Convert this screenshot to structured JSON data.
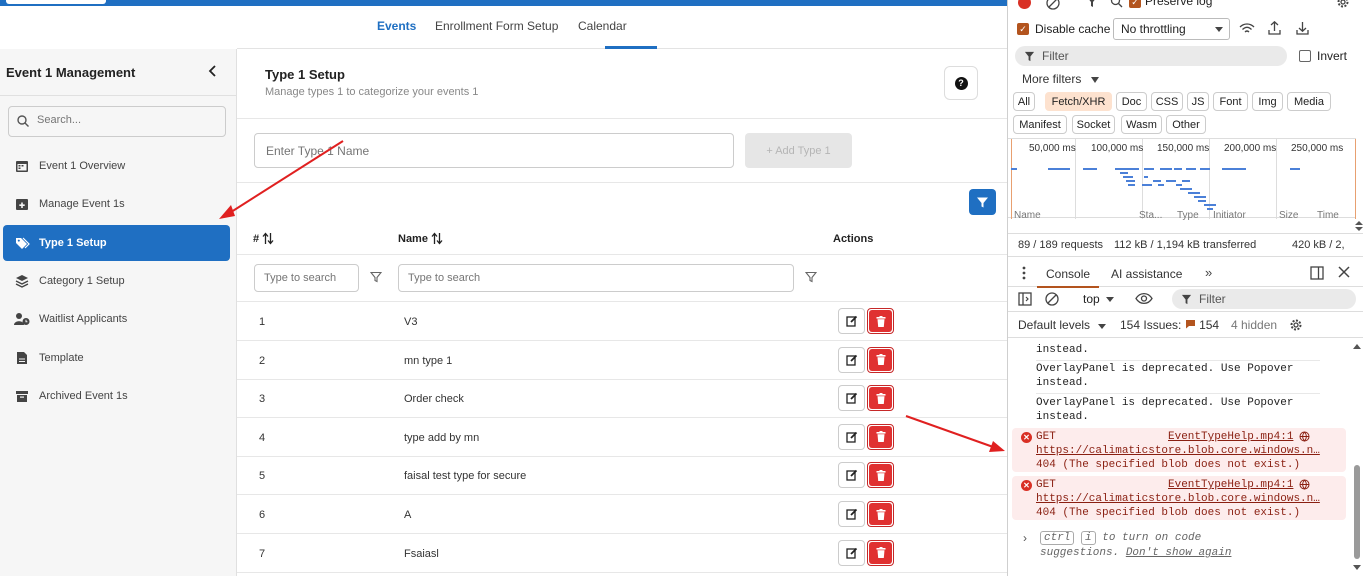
{
  "app": {
    "tabs": [
      "Events",
      "Enrollment Form Setup",
      "Calendar"
    ],
    "active_tab": "Events",
    "brand_color": "#1f6fc2",
    "sidebar": {
      "title": "Event 1 Management",
      "search_placeholder": "Search...",
      "items": [
        {
          "label": "Event 1 Overview",
          "icon": "calendar-icon"
        },
        {
          "label": "Manage Event 1s",
          "icon": "calendar-plus-icon"
        },
        {
          "label": "Type 1 Setup",
          "icon": "tags-icon",
          "active": true
        },
        {
          "label": "Category 1 Setup",
          "icon": "layers-icon"
        },
        {
          "label": "Waitlist Applicants",
          "icon": "user-clock-icon"
        },
        {
          "label": "Template",
          "icon": "document-icon"
        },
        {
          "label": "Archived Event 1s",
          "icon": "archive-box-icon"
        }
      ]
    },
    "page": {
      "title": "Type 1 Setup",
      "subtitle": "Manage types 1 to categorize your events 1",
      "help_label": "?"
    },
    "add_form": {
      "input_placeholder": "Enter Type 1 Name",
      "add_button_label": "+ Add Type 1"
    },
    "table": {
      "columns": [
        "#",
        "Name",
        "Actions"
      ],
      "filter_placeholder": "Type to search",
      "rows": [
        {
          "num": "1",
          "name": "V3"
        },
        {
          "num": "2",
          "name": "mn type 1"
        },
        {
          "num": "3",
          "name": "Order check"
        },
        {
          "num": "4",
          "name": "type add by mn"
        },
        {
          "num": "5",
          "name": "faisal test type for secure"
        },
        {
          "num": "6",
          "name": "A"
        },
        {
          "num": "7",
          "name": "Fsaiasl"
        }
      ]
    }
  },
  "devtools": {
    "preserve_log": "Preserve log",
    "disable_cache": "Disable cache",
    "throttling": "No throttling",
    "filter_placeholder": "Filter",
    "invert": "Invert",
    "more_filters": "More filters",
    "type_filters": [
      "All",
      "Fetch/XHR",
      "Doc",
      "CSS",
      "JS",
      "Font",
      "Img",
      "Media",
      "Manifest",
      "Socket",
      "Wasm",
      "Other"
    ],
    "selected_filter": "Fetch/XHR",
    "timeline_labels": [
      "50,000 ms",
      "100,000 ms",
      "150,000 ms",
      "200,000 ms",
      "250,000 ms"
    ],
    "column_headers": [
      "Name",
      "Sta...",
      "Type",
      "Initiator",
      "Size",
      "Time"
    ],
    "status": {
      "requests": "89 / 189 requests",
      "transferred": "112 kB / 1,194 kB transferred",
      "resources": "420 kB / 2,"
    },
    "drawer_tabs": [
      "Console",
      "AI assistance"
    ],
    "context": "top",
    "console_filter": "Filter",
    "default_levels": "Default levels",
    "issues_label": "154 Issues:",
    "issues_count": "154",
    "hidden": "4 hidden",
    "messages": [
      "instead.",
      "OverlayPanel is deprecated. Use Popover",
      "instead.",
      "OverlayPanel is deprecated. Use Popover",
      "instead."
    ],
    "errors": [
      {
        "method": "GET",
        "source": "EventTypeHelp.mp4:1",
        "url": "https://calimaticstore.blob.core.windows.n…",
        "text": "404 (The specified blob does not exist.)"
      },
      {
        "method": "GET",
        "source": "EventTypeHelp.mp4:1",
        "url": "https://calimaticstore.blob.core.windows.n…",
        "text": "404 (The specified blob does not exist.)"
      }
    ],
    "hint": {
      "key1": "ctrl",
      "key2": "i",
      "line1": "to turn on code",
      "line2_prefix": "suggestions.",
      "line2_link": "Don't show again"
    }
  }
}
